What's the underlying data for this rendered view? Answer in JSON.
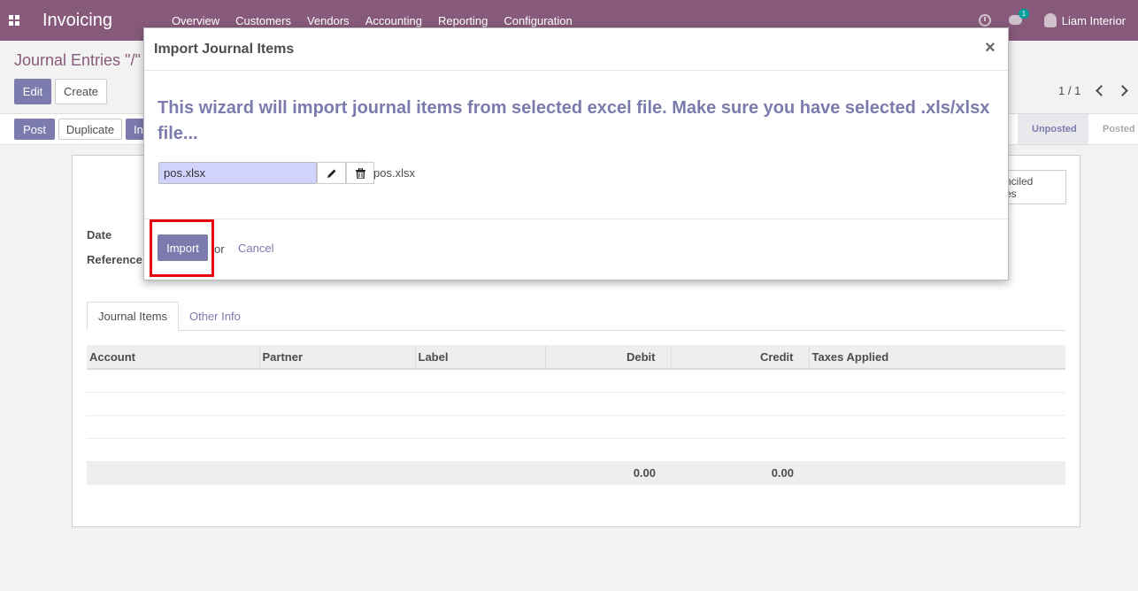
{
  "navbar": {
    "app_title": "Invoicing",
    "menu": [
      "Overview",
      "Customers",
      "Vendors",
      "Accounting",
      "Reporting",
      "Configuration"
    ],
    "chat_count": "1",
    "user_name": "Liam Interior"
  },
  "control_panel": {
    "breadcrumb": "Journal Entries \"/\"",
    "edit_label": "Edit",
    "create_label": "Create",
    "pager": "1 / 1",
    "post_label": "Post",
    "duplicate_label": "Duplicate",
    "import_partial": "In"
  },
  "statusbar": {
    "stages": [
      "Unposted",
      "Posted"
    ],
    "active_stage": "Unposted"
  },
  "form": {
    "smart_button": "nciled\nes",
    "smart_button_line1": "nciled",
    "smart_button_line2": "es",
    "date_label": "Date",
    "reference_label": "Reference",
    "tabs": [
      "Journal Items",
      "Other Info"
    ],
    "columns": [
      "Account",
      "Partner",
      "Label",
      "Debit",
      "Credit",
      "Taxes Applied"
    ],
    "total_debit": "0.00",
    "total_credit": "0.00"
  },
  "modal": {
    "title": "Import Journal Items",
    "close": "×",
    "wizard_text": "This wizard will import journal items from selected excel file. Make sure you have selected .xls/xlsx file...",
    "file_input_value": "pos.xlsx",
    "file_name": "pos.xlsx",
    "import_label": "Import",
    "or_text": "or",
    "cancel_label": "Cancel"
  },
  "colors": {
    "navbar": "#875a7b",
    "primary": "#7c7bad",
    "highlight": "#e8000d"
  }
}
